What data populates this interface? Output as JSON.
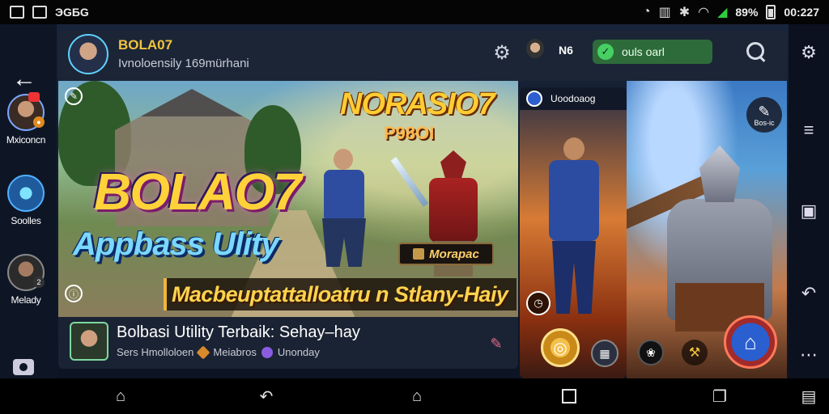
{
  "status_bar": {
    "app_label": "ЭGБG",
    "battery": "89%",
    "time": "00:227"
  },
  "left_rail": {
    "items": [
      {
        "label": "Mxiconcn"
      },
      {
        "label": "Soolles"
      },
      {
        "label": "Melady"
      }
    ]
  },
  "header": {
    "channel_name": "BOLA07",
    "channel_subtitle": "Ivnoloensily 169mürhani",
    "user_label": "N6",
    "pill_label": "ouls oarl"
  },
  "banner": {
    "title_right": "NORASIO7",
    "title_right_sub": "P98OI",
    "logo_text": "BOLAO7",
    "logo_subtitle": "Appbass Ulity",
    "tag_label": "Morapac",
    "tagline": "Macbeuptattalloatru n Stlany-Haiy"
  },
  "info": {
    "title": "Bolbasi Utility Terbaik: Sehay–hay",
    "meta_1": "Sers Hmolloloen",
    "meta_2": "Meiabros",
    "meta_3": "Unonday"
  },
  "side_card": {
    "title": "Uoodoaog"
  },
  "hero_art": {
    "edit_label": "Bos-ic"
  }
}
